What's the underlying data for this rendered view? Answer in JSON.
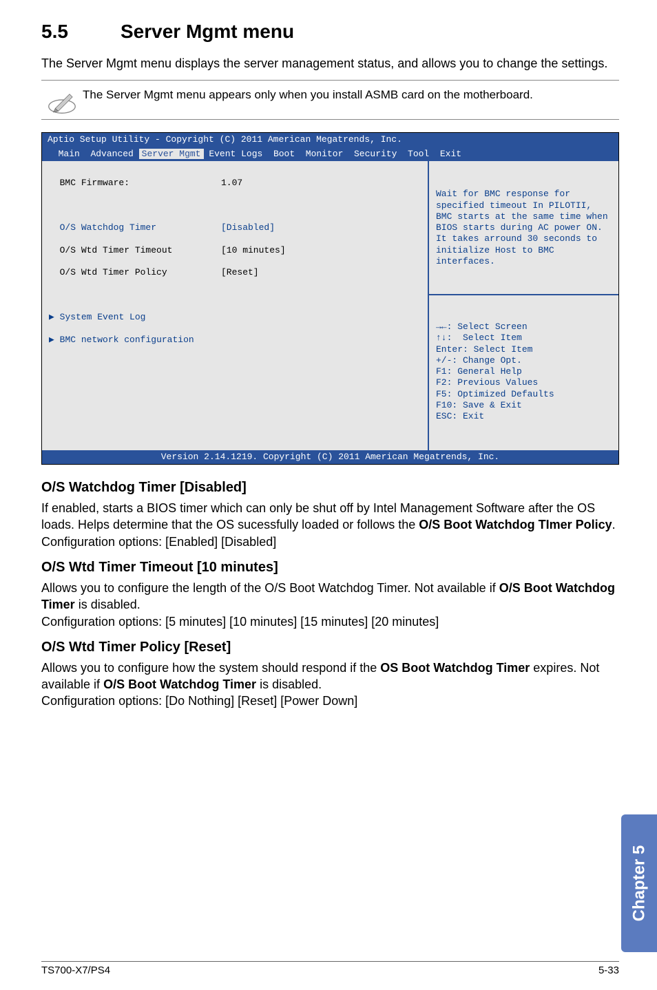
{
  "section": {
    "number": "5.5",
    "title": "Server Mgmt menu"
  },
  "intro": "The Server Mgmt menu displays the server management status, and allows you to change the settings.",
  "note": "The Server Mgmt menu appears only when you install ASMB card on the motherboard.",
  "bios": {
    "title": "Aptio Setup Utility - Copyright (C) 2011 American Megatrends, Inc.",
    "menus": {
      "m1": "Main",
      "m2": "Advanced",
      "m3": "Server Mgmt",
      "m4": "Event Logs",
      "m5": "Boot",
      "m6": "Monitor",
      "m7": "Security",
      "m8": "Tool",
      "m9": "Exit"
    },
    "left": {
      "firmware_label": "BMC Firmware:",
      "firmware_value": "1.07",
      "watchdog_label": "O/S Watchdog Timer",
      "watchdog_value": "[Disabled]",
      "timeout_label": "O/S Wtd Timer Timeout",
      "timeout_value": "[10 minutes]",
      "policy_label": "O/S Wtd Timer Policy",
      "policy_value": "[Reset]",
      "syslog": "System Event Log",
      "bmcnet": "BMC network configuration"
    },
    "help": "Wait for BMC response for specified timeout In PILOTII, BMC starts at the same time when BIOS starts during AC power ON. It takes arround 30 seconds to initialize Host to BMC interfaces.",
    "keys": "→←: Select Screen\n↑↓:  Select Item\nEnter: Select Item\n+/-: Change Opt.\nF1: General Help\nF2: Previous Values\nF5: Optimized Defaults\nF10: Save & Exit\nESC: Exit",
    "footer": "Version 2.14.1219. Copyright (C) 2011 American Megatrends, Inc."
  },
  "subs": {
    "a_head": "O/S Watchdog Timer [Disabled]",
    "a_p1": "If enabled, starts a BIOS timer which can only be shut off by Intel Management Software after the OS loads. Helps determine that the OS sucessfully loaded or follows the ",
    "a_bold": "O/S Boot Watchdog TImer Policy",
    "a_p2": ".",
    "a_cfg": "Configuration options: [Enabled] [Disabled]",
    "b_head": "O/S Wtd Timer Timeout [10 minutes]",
    "b_p1": "Allows you to configure the length of the O/S Boot Watchdog Timer. Not available if ",
    "b_bold": "O/S Boot Watchdog Timer",
    "b_p2": " is disabled.",
    "b_cfg": "Configuration options: [5 minutes] [10 minutes] [15 minutes] [20 minutes]",
    "c_head": "O/S Wtd Timer Policy [Reset]",
    "c_p1": "Allows you to configure how the system should respond if the ",
    "c_bold1": "OS Boot Watchdog Timer",
    "c_p2": " expires. Not available if ",
    "c_bold2": "O/S Boot Watchdog Timer",
    "c_p3": " is disabled.",
    "c_cfg": "Configuration options: [Do Nothing] [Reset] [Power Down]"
  },
  "chapter_tab": "Chapter 5",
  "footer": {
    "left": "TS700-X7/PS4",
    "right": "5-33"
  }
}
